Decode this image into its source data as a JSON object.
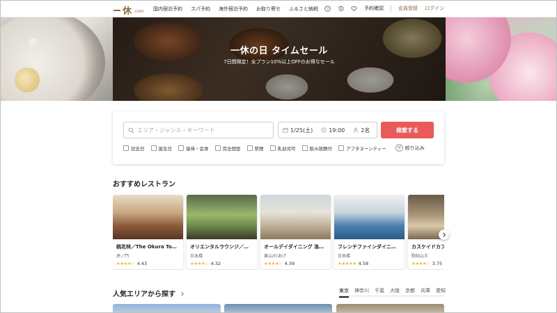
{
  "header": {
    "logo_kanji": "休",
    "logo_suffix": ".com",
    "nav": [
      "国内宿泊予約",
      "スパ予約",
      "海外宿泊予約",
      "お取り寄せ",
      "ふるさと納税"
    ],
    "reservation_check": "予約確認",
    "signup": "会員登録",
    "login": "ログイン"
  },
  "hero": {
    "title": "一休の日 タイムセール",
    "subtitle": "7日間限定！全プラン10%以上OFFのお得なセール"
  },
  "search": {
    "keyword_placeholder": "エリア・ジャンル・キーワード",
    "date": "1/25(土)",
    "time": "19:00",
    "people": "2名",
    "button": "検索する",
    "checkboxes": [
      "記念日",
      "誕生日",
      "接待・会食",
      "完全個室",
      "禁煙",
      "乳幼児可",
      "飲み放題付",
      "アフタヌーンティー"
    ],
    "filter_label": "絞り込み"
  },
  "recommended": {
    "title": "おすすめレストラン",
    "restaurants": [
      {
        "name": "桃花林／The Okura To…",
        "area": "虎ノ門",
        "rating": "4.43",
        "stars": 4.43
      },
      {
        "name": "オリエンタルラウンジ／…",
        "area": "日本橋",
        "rating": "4.32",
        "stars": 4.32
      },
      {
        "name": "オールデイダイニング 洛…",
        "area": "東山/わあげ",
        "rating": "4.39",
        "stars": 4.39
      },
      {
        "name": "フレンチファインダイニ…",
        "area": "日本橋",
        "rating": "4.58",
        "stars": 4.58
      },
      {
        "name": "カスケイドカフ",
        "area": "駒知山王",
        "rating": "3.75",
        "stars": 3.75
      }
    ]
  },
  "areas": {
    "title": "人気エリアから探す",
    "tabs": [
      "東京",
      "神奈川",
      "千葉",
      "大阪",
      "京都",
      "兵庫",
      "愛知"
    ],
    "active_tab": "東京"
  },
  "colors": {
    "brand": "#8b6d3f",
    "search_button": "#e95a5b",
    "star": "#f1b43c"
  }
}
